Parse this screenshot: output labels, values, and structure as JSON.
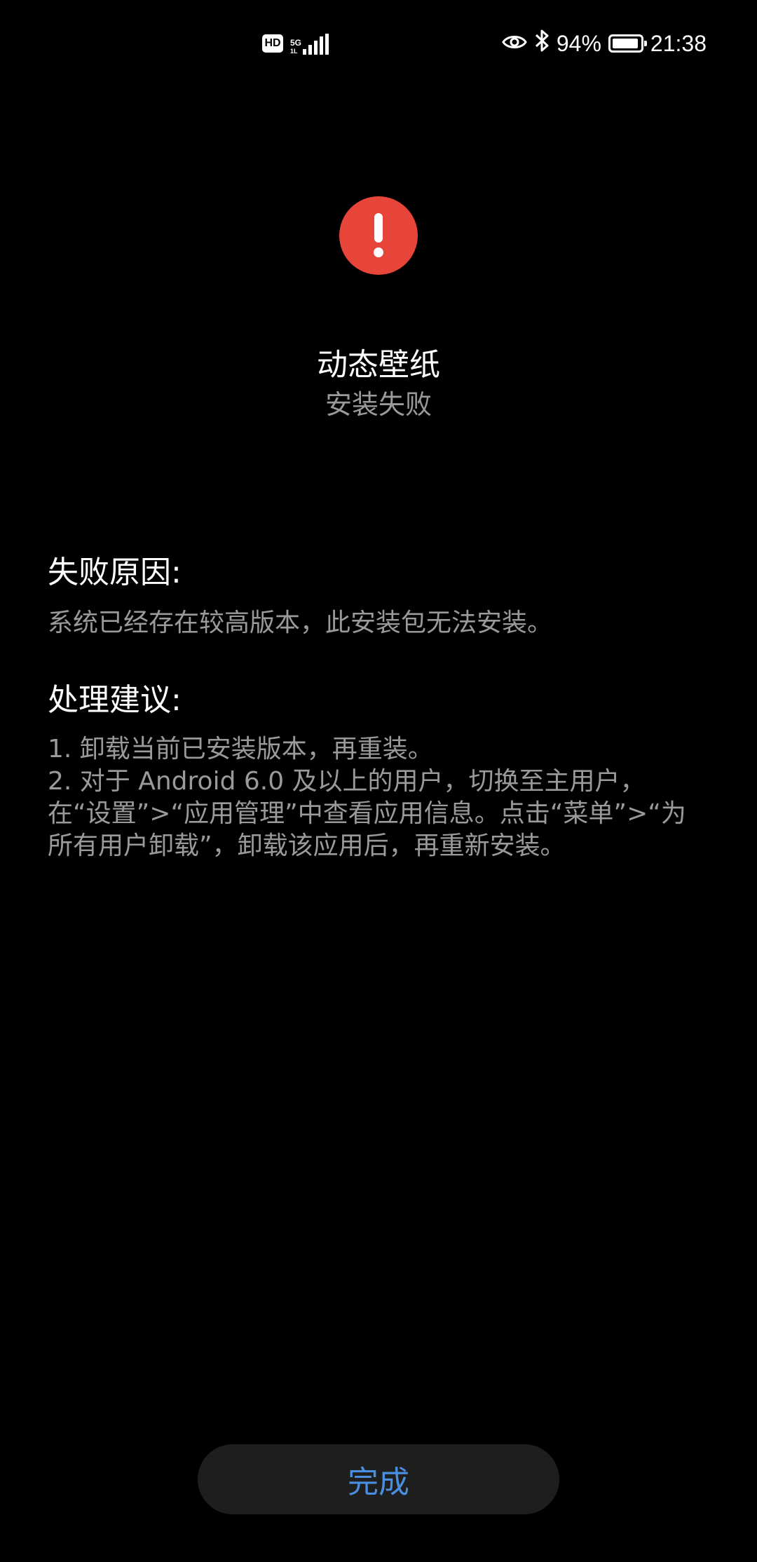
{
  "status_bar": {
    "hd_label": "HD",
    "network_label": "5G",
    "network_sub_label": "1L",
    "battery_percent": "94%",
    "battery_level": 0.94,
    "time": "21:38",
    "icons": [
      "hd-icon",
      "signal-icon",
      "eye-icon",
      "bluetooth-icon",
      "battery-icon"
    ]
  },
  "header": {
    "icon": "alert-icon",
    "icon_color": "#e8453a",
    "app_name": "动态壁纸",
    "status": "安装失败"
  },
  "failure_reason": {
    "title": "失败原因:",
    "text": "系统已经存在较高版本，此安装包无法安装。"
  },
  "suggestions": {
    "title": "处理建议:",
    "items": [
      "1. 卸载当前已安装版本，再重装。",
      "2. 对于 Android 6.0 及以上的用户，切换至主用户，在“设置”>“应用管理”中查看应用信息。点击“菜单”>“为所有用户卸载”，卸载该应用后，再重新安装。"
    ]
  },
  "footer": {
    "done_label": "完成",
    "accent_color": "#4a8ee0"
  }
}
